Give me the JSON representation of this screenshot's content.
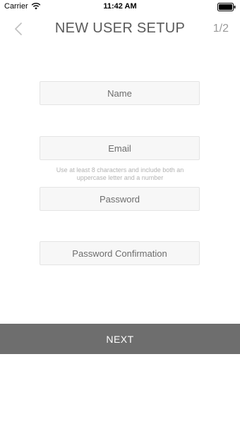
{
  "status_bar": {
    "carrier": "Carrier",
    "time": "11:42 AM"
  },
  "header": {
    "title": "NEW USER SETUP",
    "step": "1/2"
  },
  "form": {
    "name_placeholder": "Name",
    "email_placeholder": "Email",
    "password_hint": "Use at least 8 characters and include both an uppercase letter and a number",
    "password_placeholder": "Password",
    "password_confirmation_placeholder": "Password Confirmation"
  },
  "footer": {
    "next_label": "NEXT"
  },
  "colors": {
    "next_button_bg": "#6e6e6e",
    "field_bg": "#f7f7f7",
    "title_text": "#5a5a5a",
    "hint_text": "#b3b3b3"
  },
  "icons": [
    "wifi-icon",
    "battery-icon",
    "chevron-left-icon"
  ]
}
